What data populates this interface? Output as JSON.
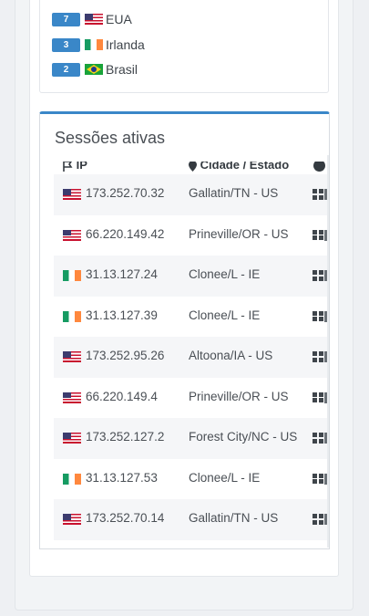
{
  "countries": [
    {
      "count": "7",
      "flag": "us-flag",
      "name": "EUA"
    },
    {
      "count": "3",
      "flag": "ie-flag",
      "name": "Irlanda"
    },
    {
      "count": "2",
      "flag": "br-flag",
      "name": "Brasil"
    }
  ],
  "sessions_card": {
    "title": "Sessões ativas",
    "headers": {
      "ip": "IP",
      "city": "Cidade / Estado",
      "os": "i"
    },
    "rows": [
      {
        "flag": "us-flag",
        "ip": "173.252.70.32",
        "city": "Gallatin/TN - US",
        "os": "windows-icon"
      },
      {
        "flag": "us-flag",
        "ip": "66.220.149.42",
        "city": "Prineville/OR - US",
        "os": "windows-icon"
      },
      {
        "flag": "ie-flag",
        "ip": "31.13.127.24",
        "city": "Clonee/L - IE",
        "os": "windows-icon"
      },
      {
        "flag": "ie-flag",
        "ip": "31.13.127.39",
        "city": "Clonee/L - IE",
        "os": "windows-icon"
      },
      {
        "flag": "us-flag",
        "ip": "173.252.95.26",
        "city": "Altoona/IA - US",
        "os": "windows-icon"
      },
      {
        "flag": "us-flag",
        "ip": "66.220.149.4",
        "city": "Prineville/OR - US",
        "os": "windows-icon"
      },
      {
        "flag": "us-flag",
        "ip": "173.252.127.2",
        "city": "Forest City/NC - US",
        "os": "windows-icon"
      },
      {
        "flag": "ie-flag",
        "ip": "31.13.127.53",
        "city": "Clonee/L - IE",
        "os": "windows-icon"
      },
      {
        "flag": "us-flag",
        "ip": "173.252.70.14",
        "city": "Gallatin/TN - US",
        "os": "windows-icon"
      }
    ]
  },
  "colors": {
    "accent": "#3a87c8",
    "badge": "#3a87c8"
  }
}
